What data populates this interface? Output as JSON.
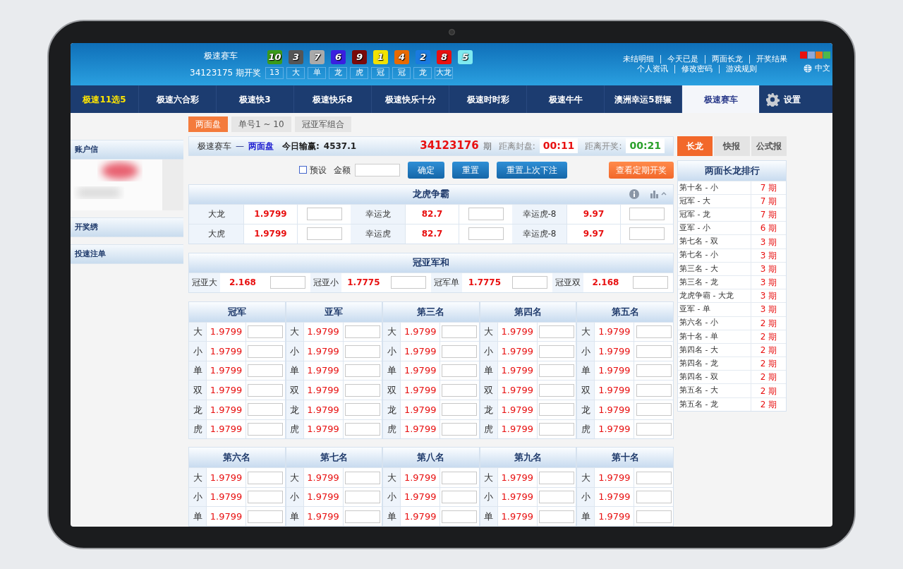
{
  "header": {
    "game": "极速赛车",
    "draw_label": "34123175 期开奖",
    "balls": [
      {
        "number": "10",
        "color": "#3a9a1a"
      },
      {
        "number": "3",
        "color": "#555555"
      },
      {
        "number": "7",
        "color": "#aaaaaa"
      },
      {
        "number": "6",
        "color": "#3a1fe0"
      },
      {
        "number": "9",
        "color": "#7a0a0a"
      },
      {
        "number": "1",
        "color": "#f2e200"
      },
      {
        "number": "4",
        "color": "#e86a00"
      },
      {
        "number": "2",
        "color": "#1a7ae0"
      },
      {
        "number": "8",
        "color": "#e81010"
      },
      {
        "number": "5",
        "color": "#7eeaf0"
      }
    ],
    "results": [
      "13",
      "大",
      "单",
      "龙",
      "虎",
      "冠",
      "冠",
      "龙",
      "大龙"
    ],
    "links": [
      [
        "未结明细",
        "今天已是",
        "两面长龙",
        "开奖结果"
      ],
      [
        "个人资讯",
        "修改密码",
        "游戏规则"
      ]
    ],
    "swatches": [
      {
        "color": "#e81010"
      },
      {
        "color": "#8fa8d8"
      },
      {
        "color": "#e8741a"
      },
      {
        "color": "#4cb84c"
      }
    ],
    "language": "中文"
  },
  "nav": {
    "items": [
      {
        "label": "极速11选5",
        "selected": false,
        "highlight": true
      },
      {
        "label": "极速六合彩",
        "selected": false,
        "highlight": false
      },
      {
        "label": "极速快3",
        "selected": false,
        "highlight": false
      },
      {
        "label": "极速快乐8",
        "selected": false,
        "highlight": false
      },
      {
        "label": "极速快乐十分",
        "selected": false,
        "highlight": false
      },
      {
        "label": "极速时时彩",
        "selected": false,
        "highlight": false
      },
      {
        "label": "极速牛牛",
        "selected": false,
        "highlight": false
      },
      {
        "label": "澳洲幸运5群辗",
        "selected": false,
        "highlight": false
      },
      {
        "label": "极速赛车",
        "selected": true,
        "highlight": false
      }
    ],
    "settings": "设置"
  },
  "subtabs": [
    {
      "label": "两面盘",
      "selected": true
    },
    {
      "label": "单号1 ~ 10",
      "selected": false
    },
    {
      "label": "冠亚军组合",
      "selected": false
    }
  ],
  "sidebar": {
    "items": [
      "账户信",
      "开奖绣",
      "投速注单"
    ]
  },
  "panel": {
    "game": "极速赛车",
    "separator": "—",
    "mode": "两面盘",
    "profit_label": "今日输赢:",
    "profit": "4537.1",
    "period": "34123176",
    "period_suffix": "期",
    "close_label": "距离封盘:",
    "close_time": "00:11",
    "open_label": "距离开奖:",
    "open_time": "00:21"
  },
  "controls": {
    "preset": {
      "label": "预设",
      "checked": false
    },
    "amount_label": "金额",
    "buttons": [
      "确定",
      "重置",
      "重置上次下注"
    ],
    "view_button": "查看定期开奖"
  },
  "dragon_tiger": {
    "title": "龙虎争霸",
    "rows": [
      [
        {
          "label": "大龙",
          "odds": "1.9799"
        },
        {
          "label": "幸运龙",
          "odds": "82.7"
        },
        {
          "label": "幸运虎-8",
          "odds": "9.97"
        }
      ],
      [
        {
          "label": "大虎",
          "odds": "1.9799"
        },
        {
          "label": "幸运虎",
          "odds": "82.7"
        },
        {
          "label": "幸运虎-8",
          "odds": "9.97"
        }
      ]
    ]
  },
  "sum": {
    "title": "冠亚军和",
    "items": [
      {
        "label": "冠亚大",
        "odds": "2.168"
      },
      {
        "label": "冠亚小",
        "odds": "1.7775"
      },
      {
        "label": "冠军单",
        "odds": "1.7775"
      },
      {
        "label": "冠亚双",
        "odds": "2.168"
      }
    ]
  },
  "positions": [
    {
      "title": "冠军",
      "rows": [
        {
          "label": "大",
          "odds": "1.9799"
        },
        {
          "label": "小",
          "odds": "1.9799"
        },
        {
          "label": "单",
          "odds": "1.9799"
        },
        {
          "label": "双",
          "odds": "1.9799"
        },
        {
          "label": "龙",
          "odds": "1.9799"
        },
        {
          "label": "虎",
          "odds": "1.9799"
        }
      ]
    },
    {
      "title": "亚军",
      "rows": [
        {
          "label": "大",
          "odds": "1.9799"
        },
        {
          "label": "小",
          "odds": "1.9799"
        },
        {
          "label": "单",
          "odds": "1.9799"
        },
        {
          "label": "双",
          "odds": "1.9799"
        },
        {
          "label": "龙",
          "odds": "1.9799"
        },
        {
          "label": "虎",
          "odds": "1.9799"
        }
      ]
    },
    {
      "title": "第三名",
      "rows": [
        {
          "label": "大",
          "odds": "1.9799"
        },
        {
          "label": "小",
          "odds": "1.9799"
        },
        {
          "label": "单",
          "odds": "1.9799"
        },
        {
          "label": "双",
          "odds": "1.9799"
        },
        {
          "label": "龙",
          "odds": "1.9799"
        },
        {
          "label": "虎",
          "odds": "1.9799"
        }
      ]
    },
    {
      "title": "第四名",
      "rows": [
        {
          "label": "大",
          "odds": "1.9799"
        },
        {
          "label": "小",
          "odds": "1.9799"
        },
        {
          "label": "单",
          "odds": "1.9799"
        },
        {
          "label": "双",
          "odds": "1.9799"
        },
        {
          "label": "龙",
          "odds": "1.9799"
        },
        {
          "label": "虎",
          "odds": "1.9799"
        }
      ]
    },
    {
      "title": "第五名",
      "rows": [
        {
          "label": "大",
          "odds": "1.9799"
        },
        {
          "label": "小",
          "odds": "1.9799"
        },
        {
          "label": "单",
          "odds": "1.9799"
        },
        {
          "label": "双",
          "odds": "1.9799"
        },
        {
          "label": "龙",
          "odds": "1.9799"
        },
        {
          "label": "虎",
          "odds": "1.9799"
        }
      ]
    },
    {
      "title": "第六名",
      "rows": [
        {
          "label": "大",
          "odds": "1.9799"
        },
        {
          "label": "小",
          "odds": "1.9799"
        },
        {
          "label": "单",
          "odds": "1.9799"
        }
      ]
    },
    {
      "title": "第七名",
      "rows": [
        {
          "label": "大",
          "odds": "1.9799"
        },
        {
          "label": "小",
          "odds": "1.9799"
        },
        {
          "label": "单",
          "odds": "1.9799"
        }
      ]
    },
    {
      "title": "第八名",
      "rows": [
        {
          "label": "大",
          "odds": "1.9799"
        },
        {
          "label": "小",
          "odds": "1.9799"
        },
        {
          "label": "单",
          "odds": "1.9799"
        }
      ]
    },
    {
      "title": "第九名",
      "rows": [
        {
          "label": "大",
          "odds": "1.9799"
        },
        {
          "label": "小",
          "odds": "1.9799"
        },
        {
          "label": "单",
          "odds": "1.9799"
        }
      ]
    },
    {
      "title": "第十名",
      "rows": [
        {
          "label": "大",
          "odds": "1.9799"
        },
        {
          "label": "小",
          "odds": "1.9799"
        },
        {
          "label": "单",
          "odds": "1.9799"
        }
      ]
    }
  ],
  "trends": {
    "tabs": [
      {
        "label": "长龙",
        "selected": true
      },
      {
        "label": "快报",
        "selected": false
      },
      {
        "label": "公式报",
        "selected": false
      }
    ],
    "title": "两面长龙排行",
    "rows": [
      {
        "name": "第十名 - 小",
        "count": "7 期"
      },
      {
        "name": "冠军 - 大",
        "count": "7 期"
      },
      {
        "name": "冠军 - 龙",
        "count": "7 期"
      },
      {
        "name": "亚军 - 小",
        "count": "6 期"
      },
      {
        "name": "第七名 - 双",
        "count": "3 期"
      },
      {
        "name": "第七名 - 小",
        "count": "3 期"
      },
      {
        "name": "第三名 - 大",
        "count": "3 期"
      },
      {
        "name": "第三名 - 龙",
        "count": "3 期"
      },
      {
        "name": "龙虎争霸 - 大龙",
        "count": "3 期"
      },
      {
        "name": "亚军 - 单",
        "count": "3 期"
      },
      {
        "name": "第六名 - 小",
        "count": "2 期"
      },
      {
        "name": "第十名 - 单",
        "count": "2 期"
      },
      {
        "name": "第四名 - 大",
        "count": "2 期"
      },
      {
        "name": "第四名 - 龙",
        "count": "2 期"
      },
      {
        "name": "第四名 - 双",
        "count": "2 期"
      },
      {
        "name": "第五名 - 大",
        "count": "2 期"
      },
      {
        "name": "第五名 - 龙",
        "count": "2 期"
      }
    ]
  }
}
